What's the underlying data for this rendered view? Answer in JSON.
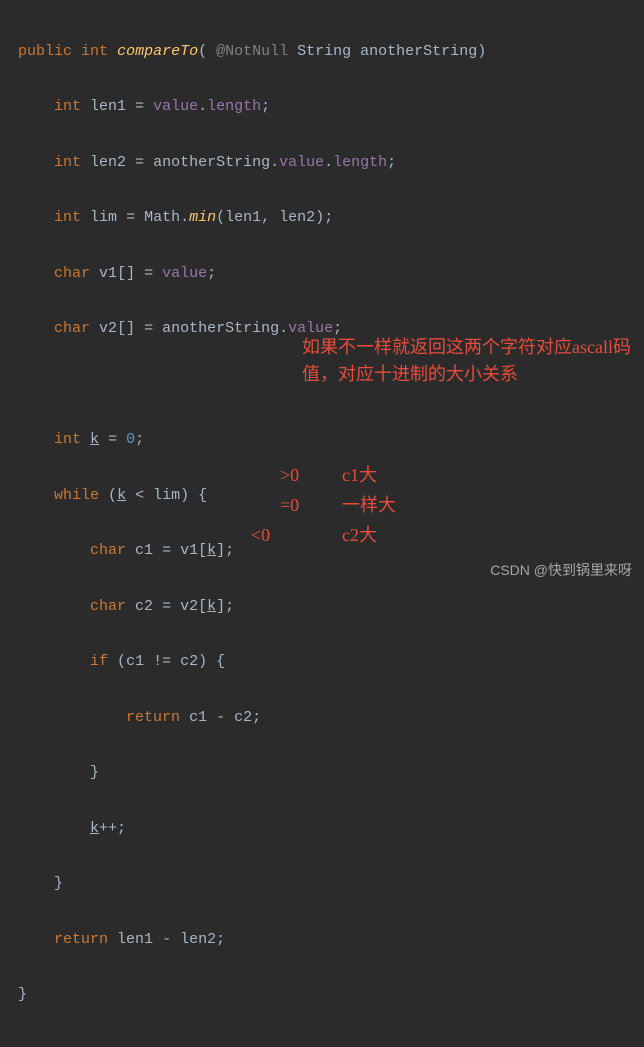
{
  "code": {
    "kw_public": "public",
    "kw_int": "int",
    "kw_char": "char",
    "kw_while": "while",
    "kw_if": "if",
    "kw_return": "return",
    "method_name": "compareTo",
    "annotation": "@NotNull",
    "param_type": "String",
    "param_name": "anotherString",
    "len1": "len1",
    "len2": "len2",
    "lim": "lim",
    "value": "value",
    "length": "length",
    "math": "Math",
    "min": "min",
    "v1": "v1",
    "v2": "v2",
    "k": "k",
    "zero": "0",
    "c1": "c1",
    "c2": "c2"
  },
  "annotations": {
    "red1": "如果不一样就返回这两个字符对应ascall码值，对应十进制的大小关系",
    "gt": ">0",
    "gt_label": "c1大",
    "eq": "=0",
    "eq_label": "一样大",
    "lt": "<0",
    "lt_label": "c2大"
  },
  "watermark": "CSDN @快到锅里来呀"
}
